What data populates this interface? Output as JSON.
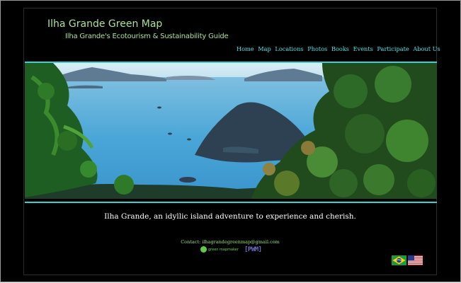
{
  "site": {
    "title": "Ilha Grande Green Map",
    "subtitle": "Ilha Grande's Ecotourism & Sustainability Guide"
  },
  "nav": {
    "items": [
      "Home",
      "Map",
      "Locations",
      "Photos",
      "Books",
      "Events",
      "Participate",
      "About Us"
    ]
  },
  "banner": {
    "alt_description": "Panoramic view of bays and islands with foliage"
  },
  "tagline": "Ilha Grande, an idyllic island adventure to experience and cherish.",
  "footer": {
    "contact": "Contact: ilhagrandegreenmap@gmail.com",
    "green_map_badge": "green mapmaker",
    "pwm_badge": "[PWM]"
  },
  "languages": [
    "Portuguese (Brazil)",
    "English (US)"
  ],
  "colors": {
    "nav": "#4fe3e1",
    "banner_border": "#35d2d0",
    "logo_text": "#a9e29a",
    "background": "#000000"
  }
}
